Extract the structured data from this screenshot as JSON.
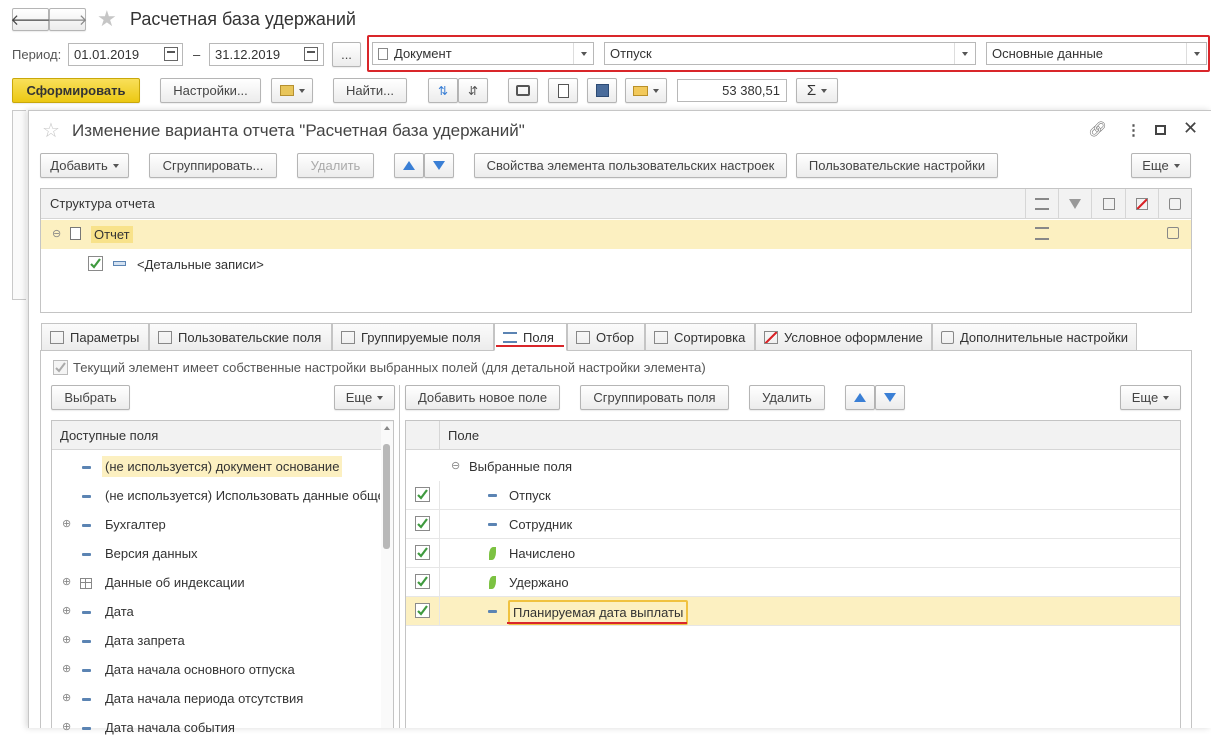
{
  "window": {
    "title": "Расчетная база удержаний"
  },
  "period": {
    "label": "Период:",
    "from": "01.01.2019",
    "dash": "–",
    "to": "31.12.2019",
    "more": "..."
  },
  "filters": {
    "field1": "Документ",
    "field2": "Отпуск",
    "field3": "Основные данные"
  },
  "toolbar": {
    "generate": "Сформировать",
    "settings": "Настройки...",
    "find": "Найти...",
    "sum_value": "53 380,51",
    "sigma": "Σ"
  },
  "dialog": {
    "title": "Изменение варианта отчета \"Расчетная база удержаний\"",
    "buttons": {
      "add": "Добавить",
      "group": "Сгруппировать...",
      "delete": "Удалить",
      "props": "Свойства элемента пользовательских настроек",
      "user_settings": "Пользовательские настройки",
      "more": "Еще"
    },
    "structure": {
      "header": "Структура отчета",
      "root": "Отчет",
      "child": "<Детальные записи>"
    },
    "tabs": [
      "Параметры",
      "Пользовательские поля",
      "Группируемые поля",
      "Поля",
      "Отбор",
      "Сортировка",
      "Условное оформление",
      "Дополнительные настройки"
    ],
    "own_settings": "Текущий элемент имеет собственные настройки выбранных полей (для детальной настройки элемента)",
    "left": {
      "choose": "Выбрать",
      "more": "Еще",
      "header": "Доступные поля",
      "items": [
        {
          "label": "(не используется) документ основание",
          "expand": false,
          "icon": "dash"
        },
        {
          "label": "(не используется) Использовать данные общего",
          "expand": false,
          "icon": "dash"
        },
        {
          "label": "Бухгалтер",
          "expand": true,
          "icon": "dash"
        },
        {
          "label": "Версия данных",
          "expand": false,
          "icon": "dash"
        },
        {
          "label": "Данные об индексации",
          "expand": true,
          "icon": "table"
        },
        {
          "label": "Дата",
          "expand": true,
          "icon": "dash"
        },
        {
          "label": "Дата запрета",
          "expand": true,
          "icon": "dash"
        },
        {
          "label": "Дата начала основного отпуска",
          "expand": true,
          "icon": "dash"
        },
        {
          "label": "Дата начала периода отсутствия",
          "expand": true,
          "icon": "dash"
        },
        {
          "label": "Дата начала события",
          "expand": true,
          "icon": "dash"
        }
      ]
    },
    "right": {
      "add_new": "Добавить новое поле",
      "group_fields": "Сгруппировать поля",
      "delete": "Удалить",
      "more": "Еще",
      "header": "Поле",
      "group": "Выбранные поля",
      "items": [
        {
          "label": "Отпуск",
          "icon": "dash"
        },
        {
          "label": "Сотрудник",
          "icon": "dash"
        },
        {
          "label": "Начислено",
          "icon": "leaf"
        },
        {
          "label": "Удержано",
          "icon": "leaf"
        },
        {
          "label": "Планируемая дата выплаты",
          "icon": "dash"
        }
      ]
    }
  },
  "colors": {
    "accent": "#f5d327",
    "highlight": "#fcf0c1",
    "red": "#d9262a",
    "blue": "#3a7fd5",
    "green": "#3f9a3f"
  }
}
